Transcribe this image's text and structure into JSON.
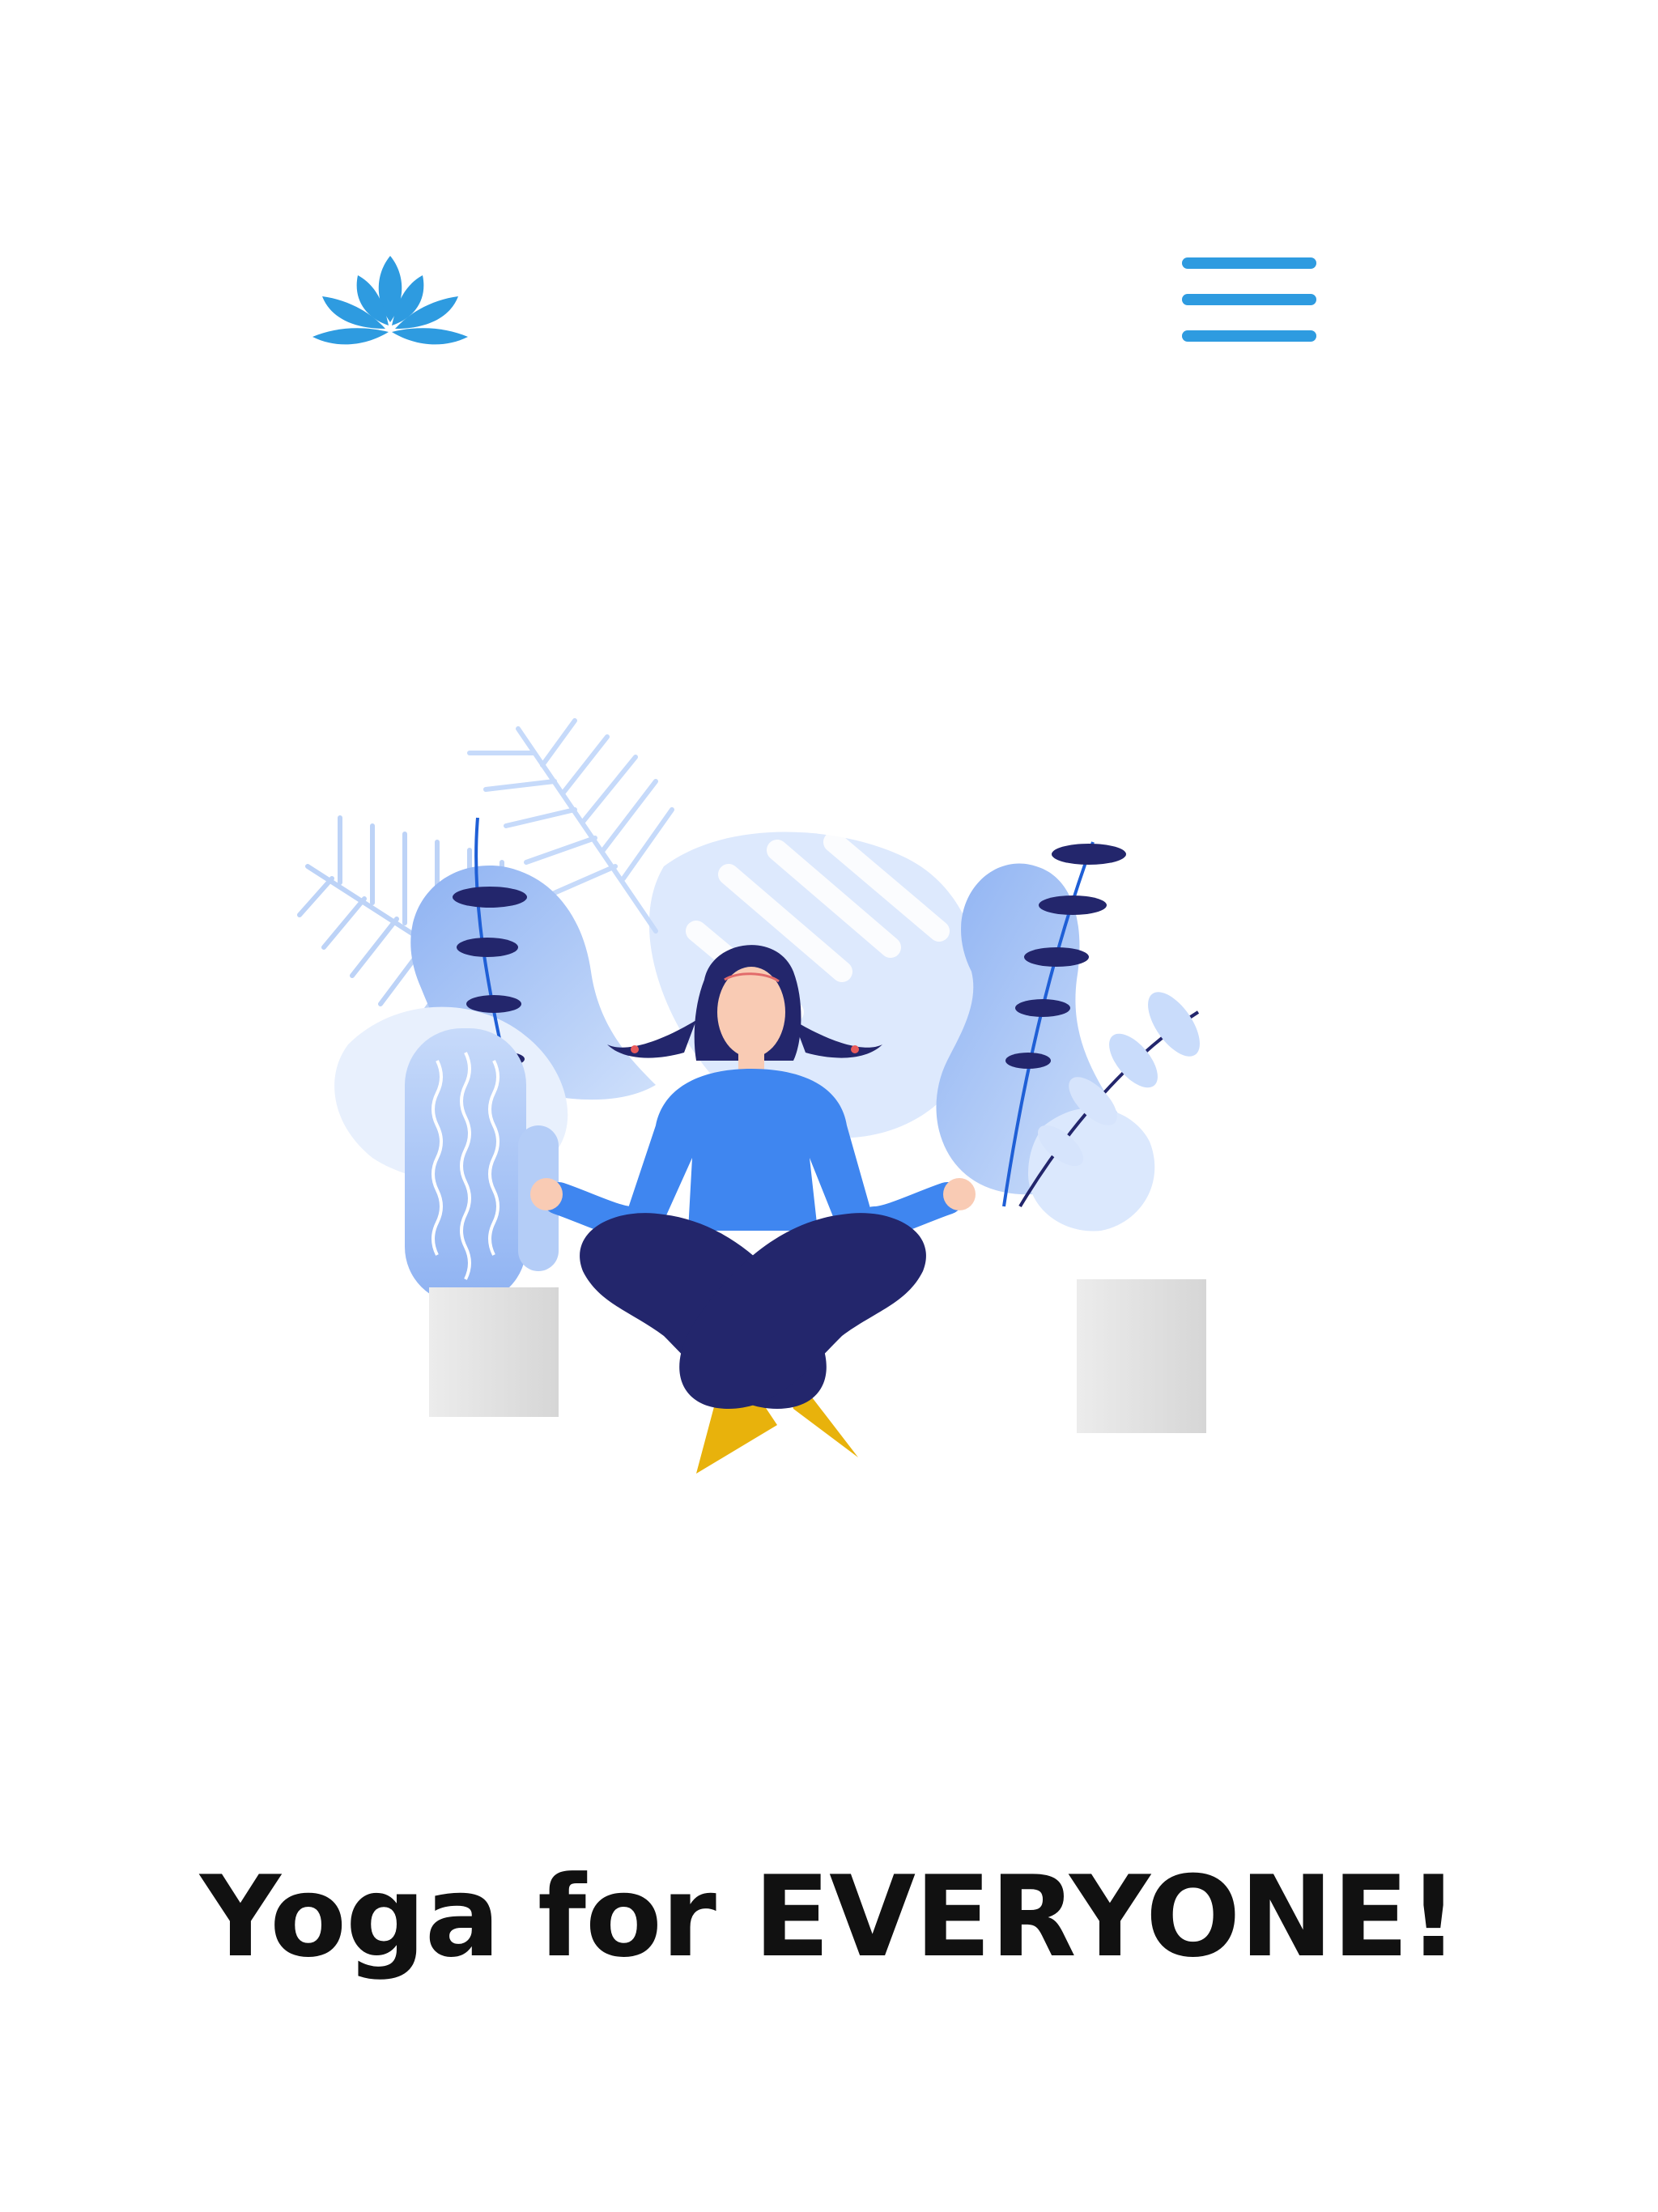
{
  "header": {
    "logo_icon": "lotus-icon",
    "menu_icon": "hamburger-menu-icon"
  },
  "hero": {
    "illustration": "meditating-woman-with-plants-illustration",
    "headline": "Yoga for EVERYONE!"
  },
  "colors": {
    "accent": "#2e9be0",
    "headline": "#111111",
    "shirt": "#3f86f0",
    "pants": "#23266c",
    "mat": "#e8b20c",
    "leaf_light": "#cfe0fb",
    "leaf_mid": "#8eb2f2",
    "pot": "#e2e2e2"
  }
}
